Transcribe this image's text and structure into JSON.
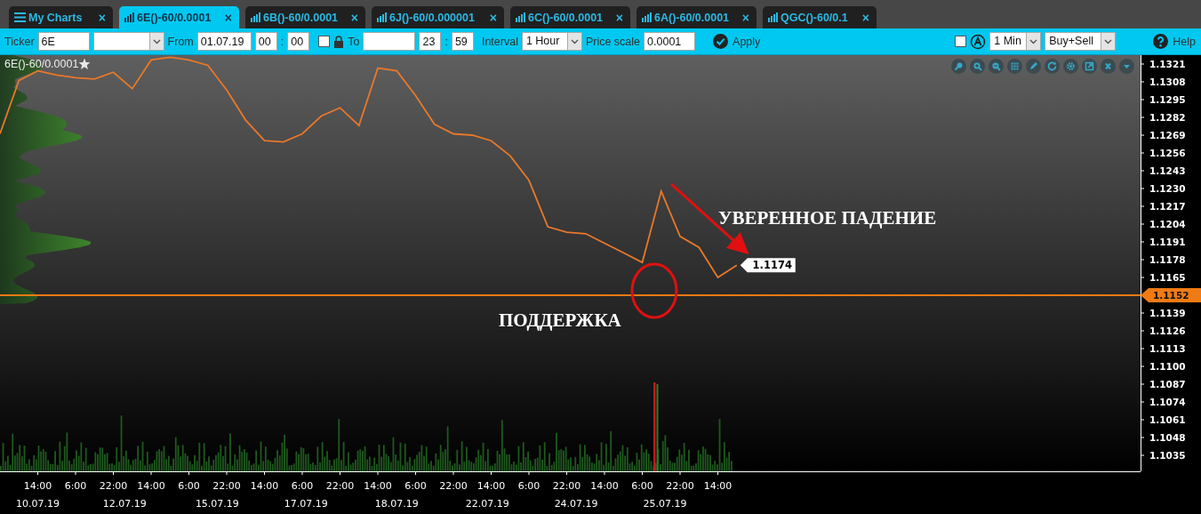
{
  "tabs": [
    {
      "kind": "menu",
      "label": "My Charts",
      "close": "×",
      "selected": false
    },
    {
      "kind": "chart",
      "label": "6E()-60/0.0001",
      "close": "×",
      "selected": true
    },
    {
      "kind": "chart",
      "label": "6B()-60/0.0001",
      "close": "×",
      "selected": false
    },
    {
      "kind": "chart",
      "label": "6J()-60/0.000001",
      "close": "×",
      "selected": false
    },
    {
      "kind": "chart",
      "label": "6C()-60/0.0001",
      "close": "×",
      "selected": false
    },
    {
      "kind": "chart",
      "label": "6A()-60/0.0001",
      "close": "×",
      "selected": false
    },
    {
      "kind": "chart",
      "label": "QGC()-60/0.1",
      "close": "×",
      "selected": false
    }
  ],
  "toolbar": {
    "ticker": {
      "label": "Ticker",
      "value": "6E"
    },
    "from": {
      "label": "From",
      "date": "01.07.19",
      "hour": "00",
      "separator": ":",
      "minute": "00"
    },
    "to_lock": {
      "checked": false
    },
    "to": {
      "label": "To",
      "hour": "23",
      "separator": ":",
      "minute": "59"
    },
    "interval": {
      "label": "Interval",
      "value": "1 Hour"
    },
    "price_scale": {
      "label": "Price scale",
      "value": "0.0001"
    },
    "apply": "Apply",
    "auto_scale": {
      "checked": false
    },
    "timeframe": "1 Min",
    "side": "Buy+Sell",
    "help": "Help"
  },
  "chart": {
    "favorite": true,
    "date_labels": [
      "10.07.19",
      "12.07.19",
      "15.07.19",
      "17.07.19",
      "18.07.19",
      "22.07.19",
      "24.07.19",
      "25.07.19"
    ],
    "chart_data": {
      "type": "line",
      "title": "6E()-60/0.0001",
      "categories": [
        null,
        null,
        "14:00",
        null,
        "6:00",
        null,
        "22:00",
        null,
        "14:00",
        null,
        "6:00",
        null,
        "22:00",
        null,
        "14:00",
        null,
        "6:00",
        null,
        "22:00",
        null,
        "14:00",
        null,
        "6:00",
        null,
        "22:00",
        null,
        "14:00",
        null,
        "6:00",
        null,
        "22:00",
        null,
        "14:00",
        null,
        "6:00",
        null,
        "22:00",
        null,
        "14:00",
        null
      ],
      "series": [
        {
          "color": "#e8782a",
          "values": [
            1.127,
            1.1309,
            1.1316,
            1.1313,
            1.1311,
            1.131,
            1.1315,
            1.1303,
            1.1324,
            1.1326,
            1.1324,
            1.132,
            1.1302,
            1.128,
            1.1265,
            1.1264,
            1.127,
            1.1283,
            1.1289,
            1.1276,
            1.1318,
            1.1316,
            1.1298,
            1.1277,
            1.127,
            1.1269,
            1.1265,
            1.1254,
            1.1236,
            1.1202,
            1.1198,
            1.1197,
            1.119,
            1.1183,
            1.1176,
            1.1228,
            1.1195,
            1.1187,
            1.1165,
            1.1174
          ]
        }
      ],
      "ylim": [
        1.10233,
        1.13275
      ],
      "yticks": [
        {
          "value": 1.1321,
          "label": "1.1321"
        },
        {
          "value": 1.1308,
          "label": "1.1308"
        },
        {
          "value": 1.1295,
          "label": "1.1295"
        },
        {
          "value": 1.1282,
          "label": "1.1282"
        },
        {
          "value": 1.1269,
          "label": "1.1269"
        },
        {
          "value": 1.1256,
          "label": "1.1256"
        },
        {
          "value": 1.1243,
          "label": "1.1243"
        },
        {
          "value": 1.123,
          "label": "1.1230"
        },
        {
          "value": 1.1217,
          "label": "1.1217"
        },
        {
          "value": 1.1204,
          "label": "1.1204"
        },
        {
          "value": 1.1191,
          "label": "1.1191"
        },
        {
          "value": 1.1178,
          "label": "1.1178"
        },
        {
          "value": 1.1165,
          "label": "1.1165"
        },
        {
          "value": 1.1139,
          "label": "1.1139"
        },
        {
          "value": 1.1126,
          "label": "1.1126"
        },
        {
          "value": 1.1113,
          "label": "1.1113"
        },
        {
          "value": 1.11,
          "label": "1.1100"
        },
        {
          "value": 1.1087,
          "label": "1.1087"
        },
        {
          "value": 1.1074,
          "label": "1.1074"
        },
        {
          "value": 1.1061,
          "label": "1.1061"
        },
        {
          "value": 1.1048,
          "label": "1.1048"
        },
        {
          "value": 1.1035,
          "label": "1.1035"
        }
      ],
      "ref_lines": [
        {
          "axis": "y",
          "value": 1.1152,
          "label": "1.1152"
        }
      ],
      "annotations": [
        "1.1174",
        "УВЕРЕННОЕ ПАДЕНИЕ",
        "ПОДДЕРЖКА"
      ]
    }
  }
}
